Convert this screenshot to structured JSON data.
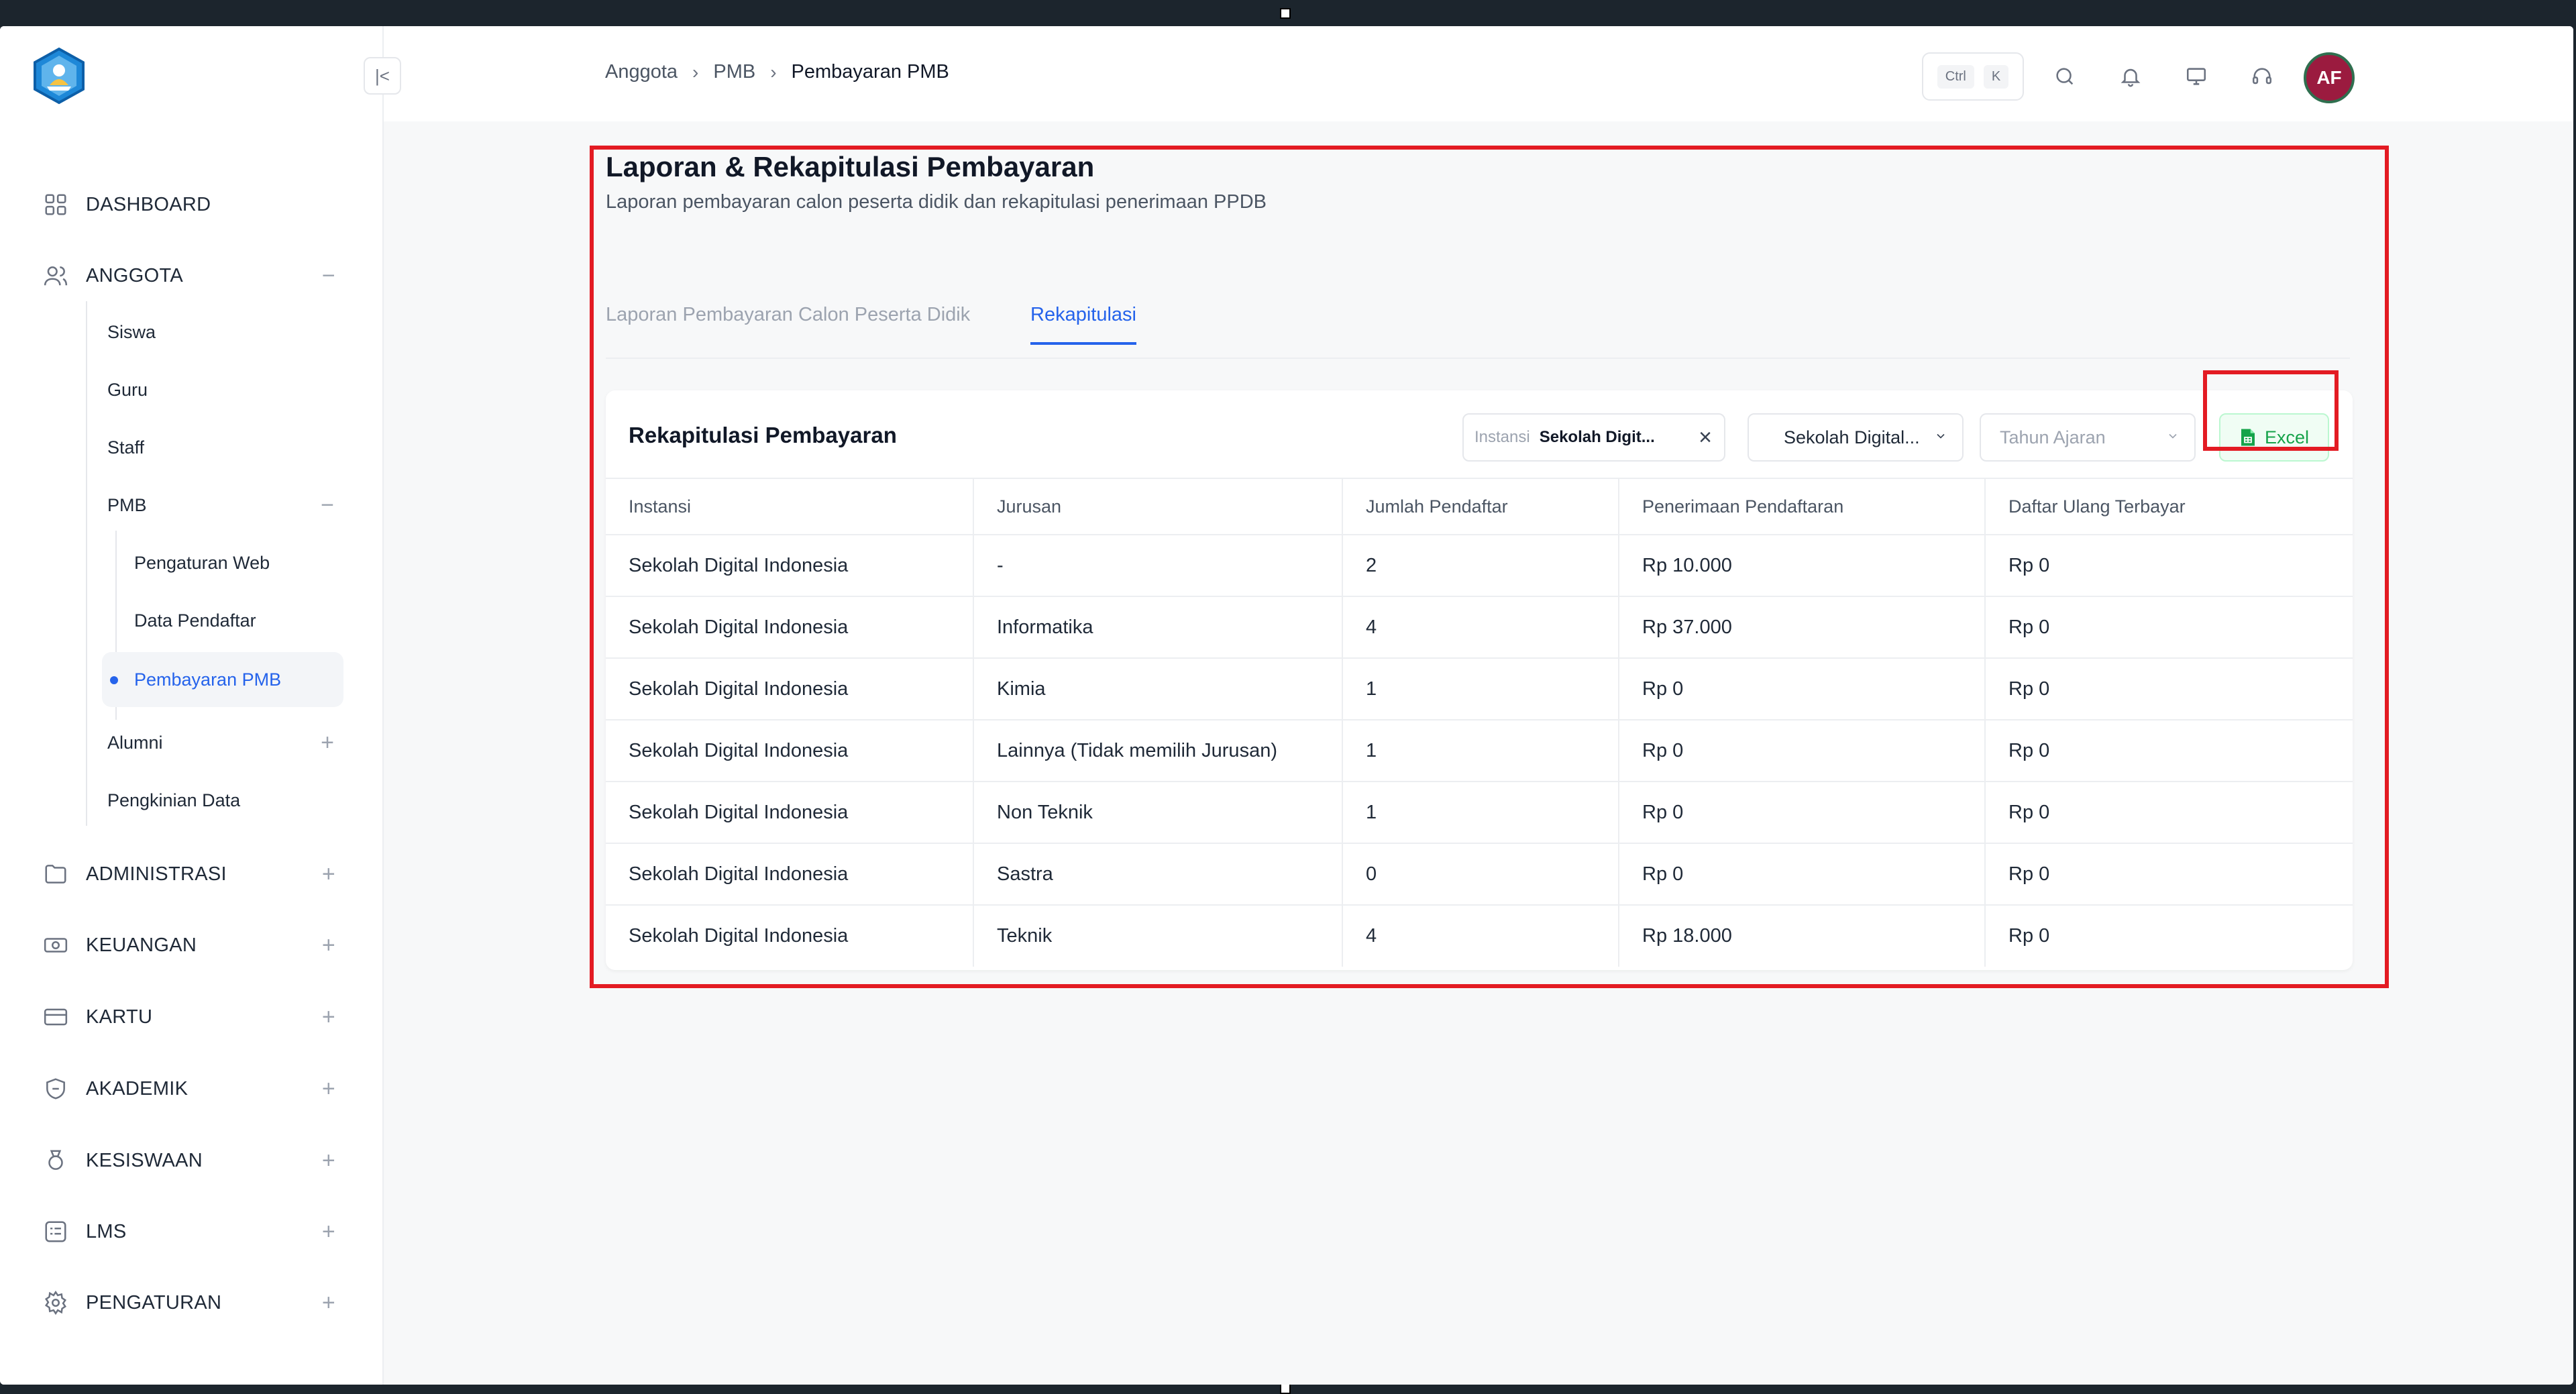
{
  "sidebar": {
    "items": [
      {
        "label": "DASHBOARD"
      },
      {
        "label": "ANGGOTA"
      },
      {
        "label": "ADMINISTRASI"
      },
      {
        "label": "KEUANGAN"
      },
      {
        "label": "KARTU"
      },
      {
        "label": "AKADEMIK"
      },
      {
        "label": "KESISWAAN"
      },
      {
        "label": "LMS"
      },
      {
        "label": "PENGATURAN"
      }
    ],
    "anggota_children": [
      {
        "label": "Siswa"
      },
      {
        "label": "Guru"
      },
      {
        "label": "Staff"
      },
      {
        "label": "PMB"
      },
      {
        "label": "Alumni"
      },
      {
        "label": "Pengkinian Data"
      }
    ],
    "pmb_children": [
      {
        "label": "Pengaturan Web"
      },
      {
        "label": "Data Pendaftar"
      },
      {
        "label": "Pembayaran PMB"
      }
    ],
    "expand_symbol": "+",
    "collapse_symbol": "−",
    "collapse_sidebar_symbol": "|<"
  },
  "header": {
    "breadcrumb": [
      "Anggota",
      "PMB",
      "Pembayaran PMB"
    ],
    "shortcut_keys": [
      "Ctrl",
      "K"
    ],
    "avatar_initials": "AF"
  },
  "page": {
    "title": "Laporan & Rekapitulasi Pembayaran",
    "subtitle": "Laporan pembayaran calon peserta didik dan rekapitulasi penerimaan PPDB",
    "tabs": [
      {
        "label": "Laporan Pembayaran Calon Peserta Didik",
        "active": false
      },
      {
        "label": "Rekapitulasi",
        "active": true
      }
    ]
  },
  "card": {
    "title": "Rekapitulasi Pembayaran",
    "filter_chip": {
      "label": "Instansi",
      "value": "Sekolah Digit...",
      "clear": "×"
    },
    "select_school": "Sekolah Digital...",
    "select_year_placeholder": "Tahun Ajaran",
    "excel_label": "Excel",
    "columns": [
      "Instansi",
      "Jurusan",
      "Jumlah Pendaftar",
      "Penerimaan Pendaftaran",
      "Daftar Ulang Terbayar"
    ],
    "rows": [
      [
        "Sekolah Digital Indonesia",
        "-",
        "2",
        "Rp 10.000",
        "Rp 0"
      ],
      [
        "Sekolah Digital Indonesia",
        "Informatika",
        "4",
        "Rp 37.000",
        "Rp 0"
      ],
      [
        "Sekolah Digital Indonesia",
        "Kimia",
        "1",
        "Rp 0",
        "Rp 0"
      ],
      [
        "Sekolah Digital Indonesia",
        "Lainnya (Tidak memilih Jurusan)",
        "1",
        "Rp 0",
        "Rp 0"
      ],
      [
        "Sekolah Digital Indonesia",
        "Non Teknik",
        "1",
        "Rp 0",
        "Rp 0"
      ],
      [
        "Sekolah Digital Indonesia",
        "Sastra",
        "0",
        "Rp 0",
        "Rp 0"
      ],
      [
        "Sekolah Digital Indonesia",
        "Teknik",
        "4",
        "Rp 18.000",
        "Rp 0"
      ]
    ]
  },
  "colors": {
    "accent": "#2563eb",
    "highlight": "#e31b23",
    "excel": "#16a34a",
    "avatar_bg": "#9b1b3f"
  }
}
